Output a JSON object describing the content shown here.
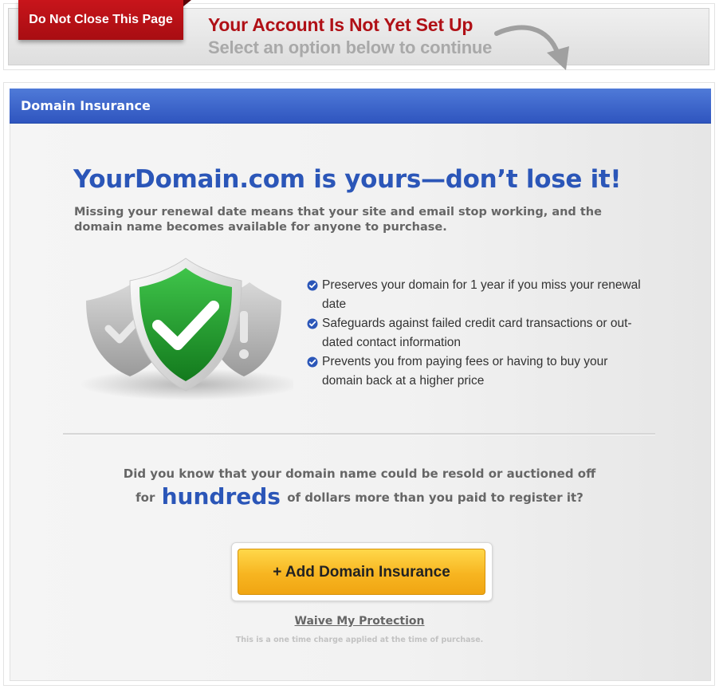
{
  "banner": {
    "ribbon_label": "Do Not Close This Page",
    "title": "Your Account Is Not Yet Set Up",
    "subtitle": "Select an option below to continue"
  },
  "panel": {
    "header_title": "Domain Insurance",
    "headline": "YourDomain.com is yours—don’t lose it!",
    "intro": "Missing your renewal date means that your site and email stop working, and the domain name becomes available for anyone to purchase.",
    "benefits": [
      "Preserves your domain for 1 year if you miss your renewal date",
      "Safeguards against failed credit card transactions or out-dated contact information",
      "Prevents you from paying fees or having to buy your domain back at a higher price"
    ],
    "question_line1": "Did you know that your domain name could be resold or auctioned off",
    "question_prefix": "for",
    "question_emphasis": "hundreds",
    "question_suffix": "of dollars more than you paid to register it?",
    "add_button_label": "+ Add Domain Insurance",
    "waive_link_label": "Waive My Protection",
    "fine_print": "This is a one time charge applied at the time of purchase."
  },
  "icons": {
    "arrow": "curved-arrow-icon",
    "shield": "green-check-shield-icon",
    "check": "blue-check-circle-icon"
  },
  "colors": {
    "ribbon_red": "#b8131a",
    "title_red": "#b01016",
    "header_blue": "#3a63c9",
    "headline_blue": "#2b56b8",
    "button_orange": "#f7b521",
    "shield_green": "#1f9a2b"
  }
}
